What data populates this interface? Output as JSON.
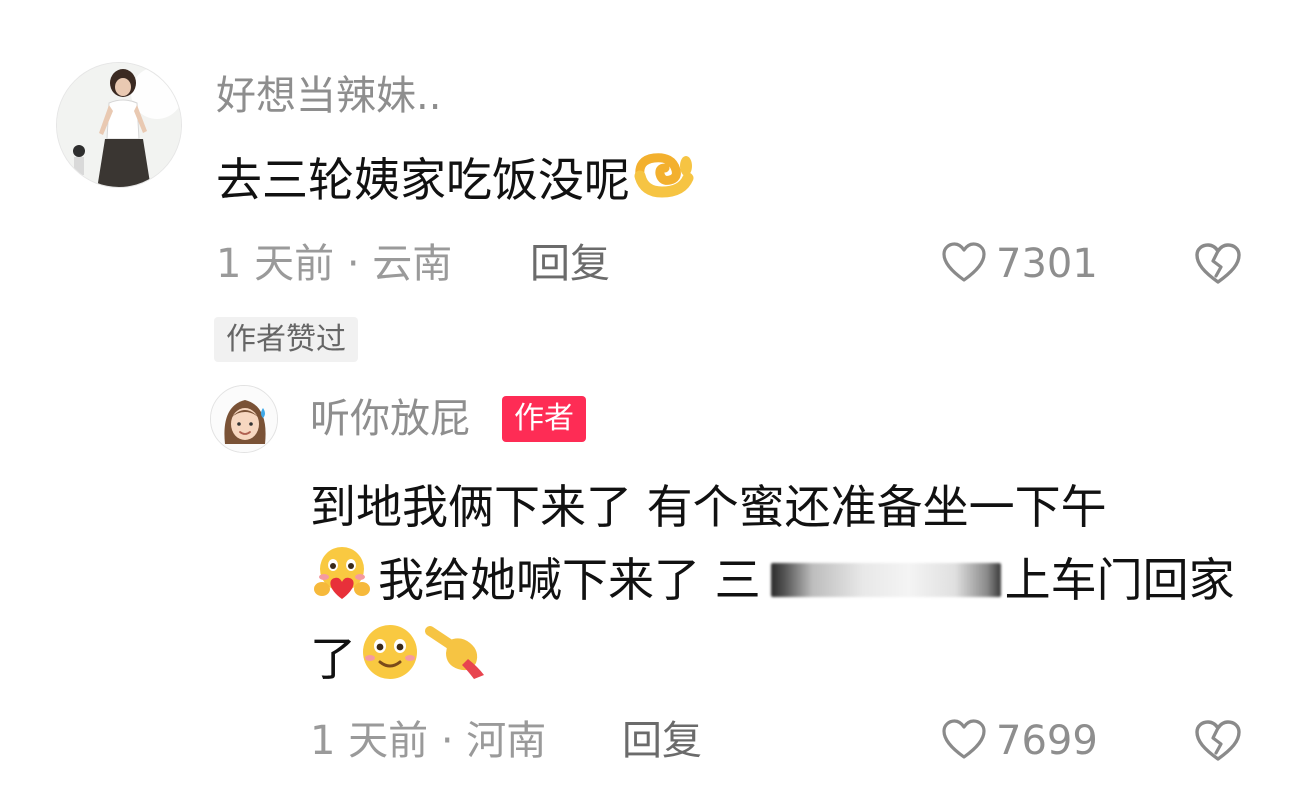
{
  "comment": {
    "username": "好想当辣妹..",
    "text": "去三轮姨家吃饭没呢",
    "time_location": "1 天前 · 云南",
    "reply_label": "回复",
    "likes": "7301",
    "author_liked_badge": "作者赞过"
  },
  "reply": {
    "username": "听你放屁",
    "author_tag": "作者",
    "line1": "到地我俩下来了 有个蜜还准备坐一下午",
    "line2_a": "我给她喊下来了 三",
    "line2_b": "上车门回家",
    "line3": "了",
    "time_location": "1 天前 · 河南",
    "reply_label": "回复",
    "likes": "7699"
  },
  "icons": {
    "like": "heart-outline-icon",
    "dislike": "broken-heart-icon"
  },
  "colors": {
    "author_tag_bg": "#fe2c55",
    "secondary_text": "#8e8e8e",
    "primary_text": "#111111"
  }
}
